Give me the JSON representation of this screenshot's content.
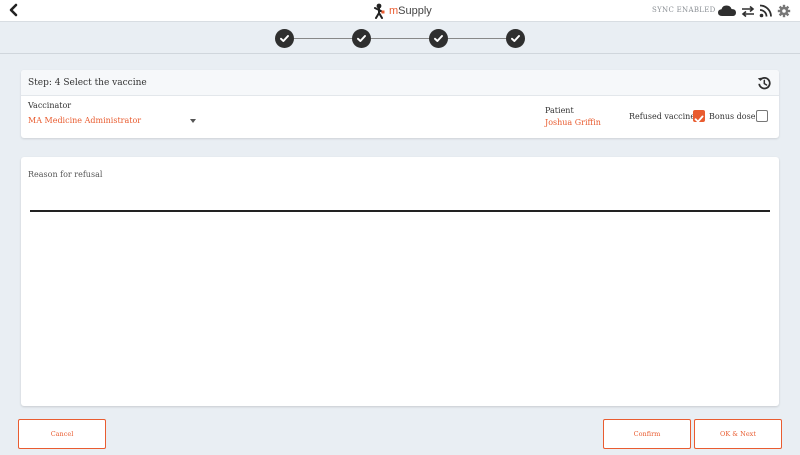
{
  "topbar": {
    "brand": "mSupply",
    "sync_status": "SYNC ENABLED"
  },
  "colors": {
    "accent": "#e95c30",
    "page_background": "#e9eef3",
    "step_complete": "#2f2f2f"
  },
  "icons": {
    "back": "chevron-left-icon",
    "cloud": "cloud-icon",
    "sync": "sync-arrows-icon",
    "feed": "rss-feed-icon",
    "settings": "gear-icon",
    "history": "history-icon",
    "step": "check-circle-icon"
  },
  "stepper": {
    "total_steps": 4,
    "completed_steps": 4
  },
  "vaccine_step": {
    "title": "Step: 4 Select the vaccine",
    "vaccinator_label": "Vaccinator",
    "vaccinator_value": "MA Medicine Administrator",
    "patient_label": "Patient",
    "patient_value": "Joshua Griffin",
    "refused_label": "Refused vaccine",
    "refused_checked": true,
    "bonus_label": "Bonus dose",
    "bonus_checked": false
  },
  "refusal": {
    "label": "Reason for refusal",
    "value": ""
  },
  "footer": {
    "cancel_label": "Cancel",
    "confirm_label": "Confirm",
    "ok_next_label": "OK & Next"
  }
}
